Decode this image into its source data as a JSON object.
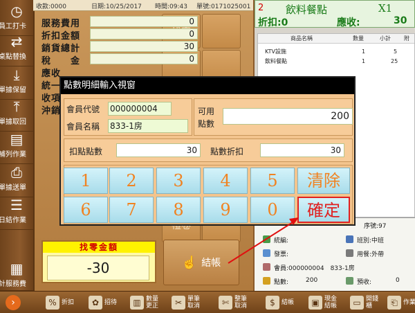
{
  "topbar": {
    "receipt_no": "收款:0000",
    "date": "日期:10/25/2017",
    "time": "時間:09:43",
    "order_no": "單號:0171025001"
  },
  "sidebar": {
    "items": [
      {
        "label": "員工打卡",
        "icon": "clock-icon",
        "glyph": "◷"
      },
      {
        "label": "桌點替換",
        "icon": "swap-icon",
        "glyph": "⇄"
      },
      {
        "label": "單據保留",
        "icon": "download-icon",
        "glyph": "⤓"
      },
      {
        "label": "單據取回",
        "icon": "upload-icon",
        "glyph": "⤒"
      },
      {
        "label": "補列作業",
        "icon": "document-icon",
        "glyph": "▤"
      },
      {
        "label": "單據送單",
        "icon": "printer-icon",
        "glyph": "⎙"
      },
      {
        "label": "日結作業",
        "icon": "database-icon",
        "glyph": "☰"
      },
      {
        "label": "計服務費",
        "icon": "receipt-icon",
        "glyph": "▦"
      }
    ]
  },
  "summary": [
    {
      "label": "服務費用",
      "value": "0"
    },
    {
      "label": "折扣金額",
      "value": "0"
    },
    {
      "label": "銷貨總計",
      "value": "30"
    },
    {
      "label": "稅　　金",
      "value": "0"
    },
    {
      "label": "應收",
      "value": ""
    },
    {
      "label": "統一",
      "value": ""
    },
    {
      "label": "收項",
      "value": ""
    },
    {
      "label": "沖銷",
      "value": ""
    }
  ],
  "grid": {
    "find_change": "找零",
    "blurred_tile": "禮卷"
  },
  "change": {
    "title": "找零金額",
    "value": "-30"
  },
  "checkout": {
    "label": "結帳"
  },
  "right": {
    "table_no": "2",
    "store_name": "飲料餐點",
    "qty": "X1",
    "discount_label": "折扣:0",
    "due_label": "應收:",
    "due_value": "30",
    "headers": [
      "商品名稱",
      "數量",
      "小計",
      "附"
    ],
    "rows": [
      {
        "name": "KTV設施",
        "qty": "1",
        "subtotal": "5"
      },
      {
        "name": "飲料餐點",
        "qty": "1",
        "subtotal": "25"
      }
    ]
  },
  "receipt": {
    "order_no": "序號:97",
    "register": "統編:",
    "shift": "班別:中班",
    "invoice": "發票:",
    "dining": "用餐:外帶",
    "member": "會員:000000004　833-1房",
    "points": "點數:",
    "points_val": "200",
    "prepay": "預收:",
    "prepay_val": "0"
  },
  "toolbar": {
    "items": [
      {
        "label": "折扣",
        "icon": "percent-icon",
        "glyph": "%"
      },
      {
        "label": "招待",
        "icon": "gift-icon",
        "glyph": "✿"
      },
      {
        "label": "數量更正",
        "icon": "quantity-icon",
        "glyph": "▥"
      },
      {
        "label": "單筆取消",
        "icon": "scissors-icon",
        "glyph": "✂"
      },
      {
        "label": "整筆取消",
        "icon": "scissors-all-icon",
        "glyph": "✄"
      },
      {
        "label": "結帳",
        "icon": "checkout-icon",
        "glyph": "$"
      },
      {
        "label": "現金結帳",
        "icon": "cash-icon",
        "glyph": "▣"
      },
      {
        "label": "開錢櫃",
        "icon": "drawer-icon",
        "glyph": "▭"
      },
      {
        "label": "作業",
        "icon": "operation-icon",
        "glyph": "⎗"
      }
    ]
  },
  "dialog": {
    "title": "點數明細輸入視窗",
    "member_id_label": "會員代號",
    "member_id": "000000004",
    "member_name_label": "會員名稱",
    "member_name": "833-1房",
    "available_label_1": "可用",
    "available_label_2": "點數",
    "available_points": "200",
    "deduct_label": "扣點點數",
    "deduct_value": "30",
    "discount_label": "點數折扣",
    "discount_value": "30",
    "keys": [
      "1",
      "2",
      "3",
      "4",
      "5",
      "6",
      "7",
      "8",
      "9",
      "0"
    ],
    "clear": "清除",
    "confirm": "確定"
  },
  "colors": {
    "accent": "#f08322",
    "confirm_border": "#e02020",
    "due_green": "#1a7b19"
  }
}
